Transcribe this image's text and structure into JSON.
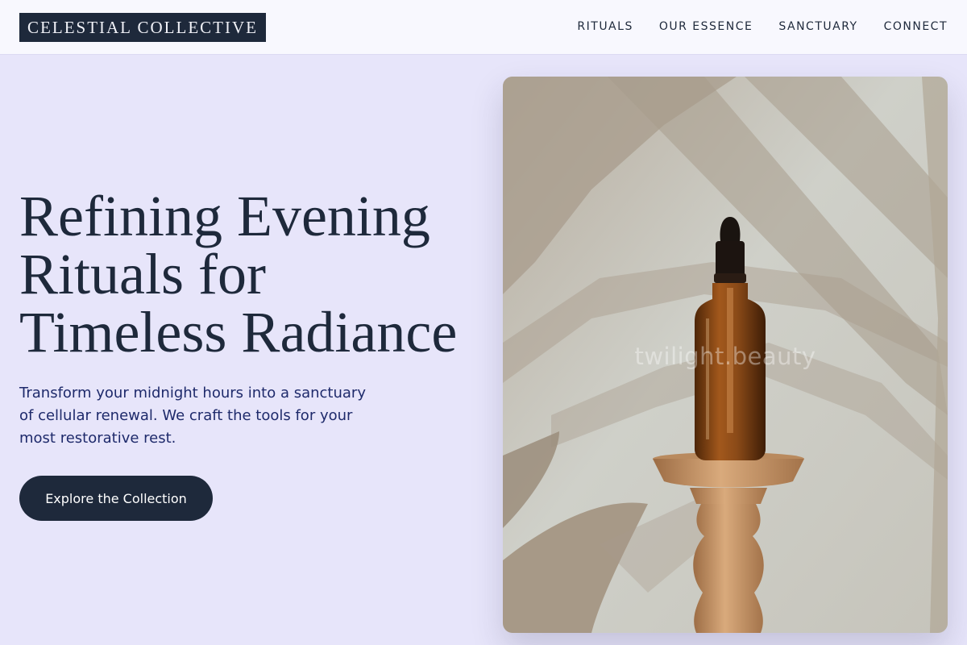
{
  "brand": {
    "name": "CELESTIAL COLLECTIVE"
  },
  "nav": {
    "items": [
      "RITUALS",
      "OUR ESSENCE",
      "SANCTUARY",
      "CONNECT"
    ]
  },
  "hero": {
    "title_lines": [
      "Refining Evening",
      "Rituals for",
      "Timeless Radiance"
    ],
    "subtitle": "Transform your midnight hours into a sanctuary of cellular renewal. We craft the tools for your most restorative rest.",
    "cta_label": "Explore the Collection"
  },
  "image": {
    "watermark": "twilight.beauty"
  },
  "colors": {
    "background": "#e7e5fa",
    "header": "#f8f8fe",
    "primary": "#1e293b",
    "subtitle": "#1e2a6b",
    "amber_bottle": "#8a4a18",
    "wall": "#cfd0c9",
    "shadow": "#a89c8c",
    "wood": "#c99a6c"
  }
}
